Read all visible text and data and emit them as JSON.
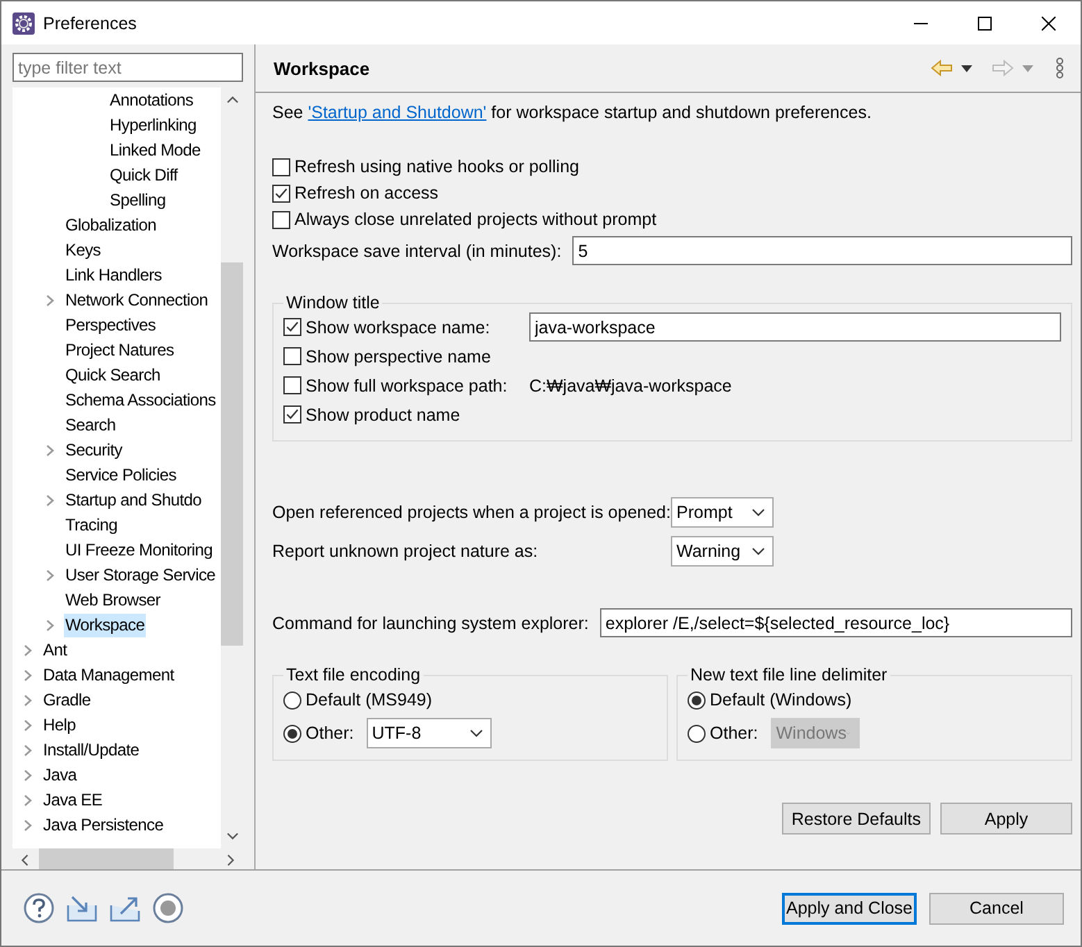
{
  "window": {
    "title": "Preferences"
  },
  "filter": {
    "placeholder": "type filter text"
  },
  "tree": [
    {
      "children": [
        {
          "children": [
            {
              "children": [
                {
                  "label": "Annotations",
                  "expandable": false,
                  "selected": false
                },
                {
                  "label": "Hyperlinking",
                  "expandable": false,
                  "selected": false
                },
                {
                  "label": "Linked Mode",
                  "expandable": false,
                  "selected": false
                },
                {
                  "label": "Quick Diff",
                  "expandable": false,
                  "selected": false
                },
                {
                  "label": "Spelling",
                  "expandable": false,
                  "selected": false
                }
              ]
            }
          ]
        },
        {
          "label": "Globalization",
          "expandable": false,
          "selected": false
        },
        {
          "label": "Keys",
          "expandable": false,
          "selected": false
        },
        {
          "label": "Link Handlers",
          "expandable": false,
          "selected": false
        },
        {
          "label": "Network Connection",
          "expandable": true,
          "selected": false
        },
        {
          "label": "Perspectives",
          "expandable": false,
          "selected": false
        },
        {
          "label": "Project Natures",
          "expandable": false,
          "selected": false
        },
        {
          "label": "Quick Search",
          "expandable": false,
          "selected": false
        },
        {
          "label": "Schema Associations",
          "expandable": false,
          "selected": false
        },
        {
          "label": "Search",
          "expandable": false,
          "selected": false
        },
        {
          "label": "Security",
          "expandable": true,
          "selected": false
        },
        {
          "label": "Service Policies",
          "expandable": false,
          "selected": false
        },
        {
          "label": "Startup and Shutdo",
          "expandable": true,
          "selected": false
        },
        {
          "label": "Tracing",
          "expandable": false,
          "selected": false
        },
        {
          "label": "UI Freeze Monitoring",
          "expandable": false,
          "selected": false
        },
        {
          "label": "User Storage Service",
          "expandable": true,
          "selected": false
        },
        {
          "label": "Web Browser",
          "expandable": false,
          "selected": false
        },
        {
          "label": "Workspace",
          "expandable": true,
          "selected": true
        }
      ]
    },
    {
      "label": "Ant",
      "expandable": true,
      "selected": false
    },
    {
      "label": "Data Management",
      "expandable": true,
      "selected": false
    },
    {
      "label": "Gradle",
      "expandable": true,
      "selected": false
    },
    {
      "label": "Help",
      "expandable": true,
      "selected": false
    },
    {
      "label": "Install/Update",
      "expandable": true,
      "selected": false
    },
    {
      "label": "Java",
      "expandable": true,
      "selected": false
    },
    {
      "label": "Java EE",
      "expandable": true,
      "selected": false
    },
    {
      "label": "Java Persistence",
      "expandable": true,
      "selected": false
    }
  ],
  "page": {
    "title": "Workspace",
    "intro": {
      "before": "See ",
      "link": "'Startup and Shutdown'",
      "after": " for workspace startup and shutdown preferences."
    },
    "options": [
      {
        "label": "Refresh using native hooks or polling",
        "checked": false
      },
      {
        "label": "Refresh on access",
        "checked": true
      },
      {
        "label": "Always close unrelated projects without prompt",
        "checked": false
      }
    ],
    "save_interval": {
      "label": "Workspace save interval (in minutes):",
      "value": "5"
    },
    "window_title": {
      "title": "Window title",
      "options": [
        {
          "kind": "field",
          "label": "Show workspace name:",
          "checked": true,
          "value": "java-workspace"
        },
        {
          "kind": "plain",
          "label": "Show perspective name",
          "checked": false
        },
        {
          "kind": "path",
          "label": "Show full workspace path:",
          "checked": false,
          "path": "C:₩java₩java-workspace"
        },
        {
          "kind": "plain",
          "label": "Show product name",
          "checked": true
        }
      ]
    },
    "dropdowns": [
      {
        "label": "Open referenced projects when a project is opened:",
        "value": "Prompt"
      },
      {
        "label": "Report unknown project nature as:",
        "value": "Warning"
      }
    ],
    "explorer": {
      "label": "Command for launching system explorer:",
      "value": "explorer /E,/select=${selected_resource_loc}"
    },
    "groups": [
      {
        "title": "Text file encoding",
        "options": [
          {
            "kind": "plain",
            "label": "Default (MS949)",
            "selected": false
          },
          {
            "kind": "combo",
            "label": "Other:",
            "selected": true,
            "value": "UTF-8",
            "disabled": false
          }
        ]
      },
      {
        "title": "New text file line delimiter",
        "options": [
          {
            "kind": "plain",
            "label": "Default (Windows)",
            "selected": true
          },
          {
            "kind": "combo",
            "label": "Other:",
            "selected": false,
            "value": "Windows",
            "disabled": true
          }
        ]
      }
    ],
    "buttons": [
      "Restore Defaults",
      "Apply"
    ]
  },
  "footer": {
    "buttons": [
      {
        "label": "Apply and Close",
        "default": true
      },
      {
        "label": "Cancel",
        "default": false
      }
    ]
  }
}
